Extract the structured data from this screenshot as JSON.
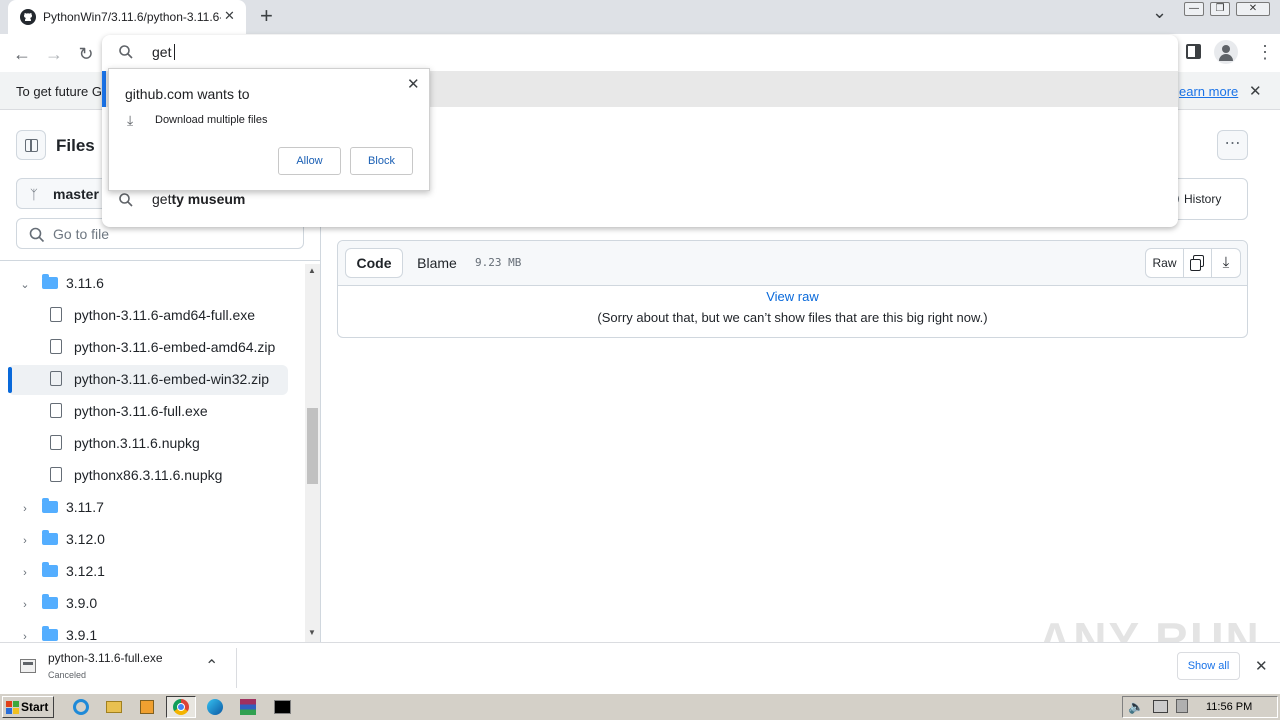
{
  "browser": {
    "tab_title": "PythonWin7/3.11.6/python-3.11.6-",
    "tab_close": "✕",
    "new_tab": "+",
    "tab_search": "⌄",
    "omnibox_text": "get",
    "omnibox_suggestion_typed": "get",
    "omnibox_suggestion_rest": "ty museum",
    "window_buttons": [
      "—",
      "❐",
      "✕"
    ]
  },
  "infobar": {
    "text": "To get future G",
    "link": "earn more",
    "close": "✕"
  },
  "permission_popup": {
    "title": "github.com wants to",
    "item": "Download multiple files",
    "allow_label": "Allow",
    "block_label": "Block",
    "close": "✕"
  },
  "sidebar": {
    "title": "Files",
    "branch": "master",
    "search_placeholder": "Go to file",
    "tree": [
      {
        "type": "folder",
        "label": "3.11.6",
        "expanded": true
      },
      {
        "type": "file",
        "label": "python-3.11.6-amd64-full.exe"
      },
      {
        "type": "file",
        "label": "python-3.11.6-embed-amd64.zip"
      },
      {
        "type": "file",
        "label": "python-3.11.6-embed-win32.zip",
        "selected": true
      },
      {
        "type": "file",
        "label": "python-3.11.6-full.exe"
      },
      {
        "type": "file",
        "label": "python.3.11.6.nupkg"
      },
      {
        "type": "file",
        "label": "pythonx86.3.11.6.nupkg"
      },
      {
        "type": "folder",
        "label": "3.11.7",
        "expanded": false
      },
      {
        "type": "folder",
        "label": "3.12.0",
        "expanded": false
      },
      {
        "type": "folder",
        "label": "3.12.1",
        "expanded": false
      },
      {
        "type": "folder",
        "label": "3.9.0",
        "expanded": false
      },
      {
        "type": "folder",
        "label": "3.9.1",
        "expanded": false
      }
    ]
  },
  "main": {
    "more_button": "⋯",
    "history_label": "History",
    "tab_code": "Code",
    "tab_blame": "Blame",
    "file_size": "9.23 MB",
    "raw_label": "Raw",
    "view_raw": "View raw",
    "message": "(Sorry about that, but we can’t show files that are this big right now.)"
  },
  "download_bar": {
    "filename": "python-3.11.6-full.exe",
    "status": "Canceled",
    "show_all": "Show all",
    "close": "✕"
  },
  "taskbar": {
    "start": "Start",
    "clock": "11:56 PM"
  },
  "watermark": "ANY RUN",
  "colors": {
    "accent": "#1a73e8",
    "github_link": "#0969da",
    "folder": "#54aeff",
    "selected_indicator": "#0969da"
  }
}
